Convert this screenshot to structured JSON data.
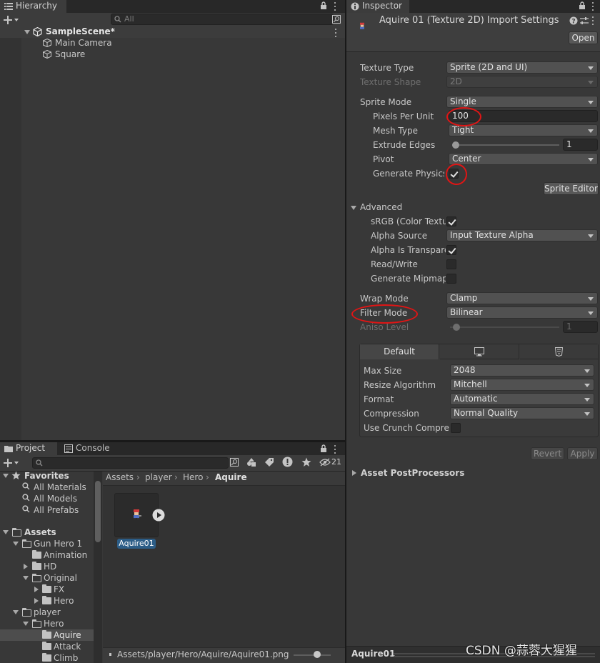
{
  "hierarchy": {
    "tab": "Hierarchy",
    "search_placeholder": "All",
    "scene": "SampleScene*",
    "objects": [
      "Main Camera",
      "Square"
    ]
  },
  "project": {
    "tab_project": "Project",
    "tab_console": "Console",
    "hidden_count": "21",
    "favorites": {
      "title": "Favorites",
      "items": [
        "All Materials",
        "All Models",
        "All Prefabs"
      ]
    },
    "assets_title": "Assets",
    "tree": [
      {
        "label": "Gun Hero 1",
        "open": true
      },
      {
        "label": "Animation",
        "open": false
      },
      {
        "label": "HD",
        "open": false
      },
      {
        "label": "Original",
        "open": true
      },
      {
        "label": "FX",
        "open": false
      },
      {
        "label": "Hero",
        "open": false
      },
      {
        "label": "player",
        "open": true
      },
      {
        "label": "Hero",
        "open": true
      },
      {
        "label": "Aquire",
        "open": false,
        "selected": true
      },
      {
        "label": "Attack",
        "open": false
      },
      {
        "label": "Climb",
        "open": false
      }
    ],
    "breadcrumb": [
      "Assets",
      "player",
      "Hero",
      "Aquire"
    ],
    "asset_name": "Aquire01",
    "footer_path": "Assets/player/Hero/Aquire/Aquire01.png"
  },
  "inspector": {
    "tab": "Inspector",
    "header_title": "Aquire 01 (Texture 2D) Import Settings",
    "open_button": "Open",
    "texture_type": {
      "label": "Texture Type",
      "value": "Sprite (2D and UI)"
    },
    "texture_shape": {
      "label": "Texture Shape",
      "value": "2D"
    },
    "sprite_mode": {
      "label": "Sprite Mode",
      "value": "Single"
    },
    "pixels_per_unit": {
      "label": "Pixels Per Unit",
      "value": "100"
    },
    "mesh_type": {
      "label": "Mesh Type",
      "value": "Tight"
    },
    "extrude_edges": {
      "label": "Extrude Edges",
      "value": "1",
      "fraction": 0
    },
    "pivot": {
      "label": "Pivot",
      "value": "Center"
    },
    "generate_physics": {
      "label": "Generate Physics Shape",
      "checked": true
    },
    "sprite_editor_button": "Sprite Editor",
    "advanced": {
      "title": "Advanced",
      "srgb": {
        "label": "sRGB (Color Texture)",
        "checked": true
      },
      "alpha_source": {
        "label": "Alpha Source",
        "value": "Input Texture Alpha"
      },
      "alpha_transparency": {
        "label": "Alpha Is Transparency",
        "checked": true
      },
      "read_write": {
        "label": "Read/Write",
        "checked": false
      },
      "mipmaps": {
        "label": "Generate Mipmaps",
        "checked": false
      }
    },
    "wrap_mode": {
      "label": "Wrap Mode",
      "value": "Clamp"
    },
    "filter_mode": {
      "label": "Filter Mode",
      "value": "Bilinear"
    },
    "aniso_level": {
      "label": "Aniso Level",
      "value": "1",
      "fraction": 0
    },
    "platform_tabs": [
      "Default"
    ],
    "max_size": {
      "label": "Max Size",
      "value": "2048"
    },
    "resize_algorithm": {
      "label": "Resize Algorithm",
      "value": "Mitchell"
    },
    "format": {
      "label": "Format",
      "value": "Automatic"
    },
    "compression": {
      "label": "Compression",
      "value": "Normal Quality"
    },
    "crunch": {
      "label": "Use Crunch Compression",
      "checked": false
    },
    "revert_button": "Revert",
    "apply_button": "Apply",
    "asset_postprocessors": "Asset PostProcessors",
    "footer_asset": "Aquire01"
  },
  "watermark": "CSDN @蒜蓉大猩猩",
  "colors": {
    "selection_blue": "#2c5d87",
    "annotation_red": "#e01515"
  }
}
